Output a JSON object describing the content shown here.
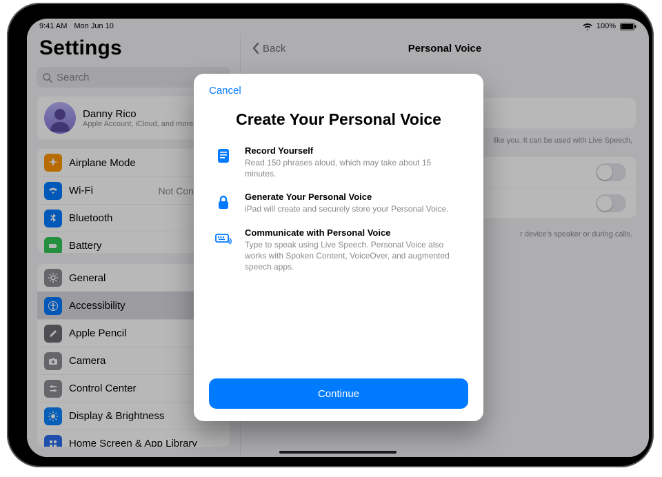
{
  "status": {
    "time": "9:41 AM",
    "date": "Mon Jun 10",
    "battery": "100%"
  },
  "sidebar": {
    "title": "Settings",
    "search_placeholder": "Search",
    "profile": {
      "name": "Danny Rico",
      "subtitle": "Apple Account, iCloud, and more"
    },
    "group1": {
      "airplane": "Airplane Mode",
      "wifi": "Wi-Fi",
      "wifi_status": "Not Connected",
      "bluetooth": "Bluetooth",
      "battery": "Battery"
    },
    "group2": {
      "general": "General",
      "accessibility": "Accessibility",
      "apple_pencil": "Apple Pencil",
      "camera": "Camera",
      "control_center": "Control Center",
      "display": "Display & Brightness",
      "home_screen": "Home Screen & App Library"
    }
  },
  "pane": {
    "back": "Back",
    "title": "Personal Voice",
    "note_top": "like you. It can be used with Live Speech,",
    "note_mid": "r device's speaker or during calls."
  },
  "modal": {
    "cancel": "Cancel",
    "title": "Create Your Personal Voice",
    "bullets": [
      {
        "head": "Record Yourself",
        "body": "Read 150 phrases aloud, which may take about 15 minutes."
      },
      {
        "head": "Generate Your Personal Voice",
        "body": "iPad will create and securely store your Personal Voice."
      },
      {
        "head": "Communicate with Personal Voice",
        "body": "Type to speak using Live Speech. Personal Voice also works with Spoken Content, VoiceOver, and augmented speech apps."
      }
    ],
    "continue": "Continue"
  }
}
